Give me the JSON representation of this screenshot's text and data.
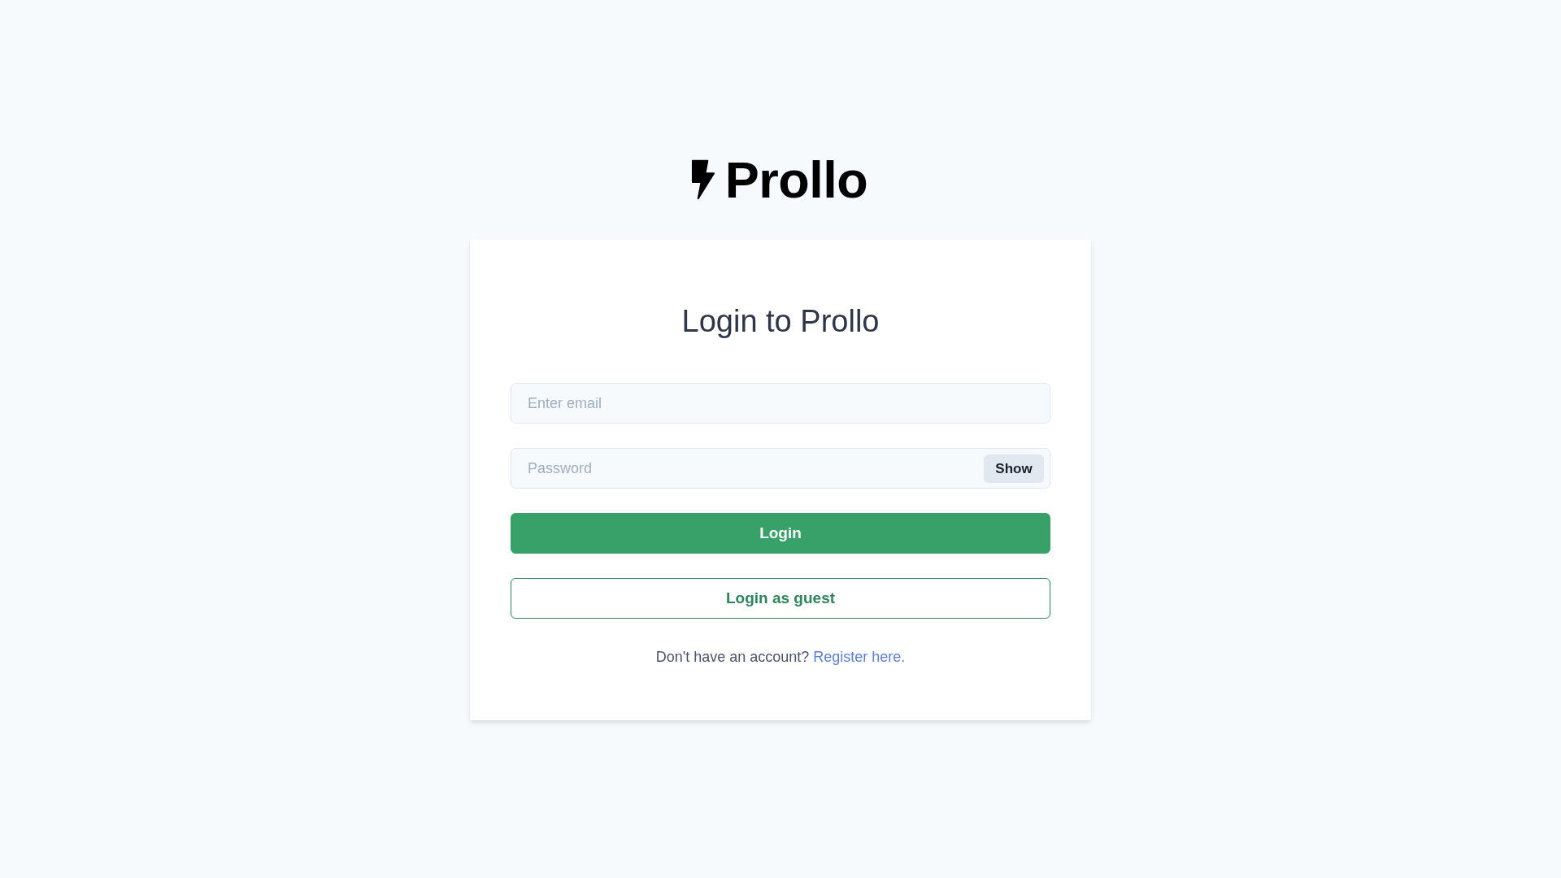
{
  "logo": {
    "text": "Prollo"
  },
  "card": {
    "title": "Login to Prollo",
    "email_field": {
      "placeholder": "Enter email"
    },
    "password_field": {
      "placeholder": "Password",
      "toggle_button": "Show"
    },
    "buttons": [
      {
        "label": "Login",
        "kind": "solid"
      },
      {
        "label": "Login as guest",
        "kind": "outline"
      }
    ],
    "footer": {
      "text": "Don't have an account?",
      "link": "Register here."
    }
  }
}
